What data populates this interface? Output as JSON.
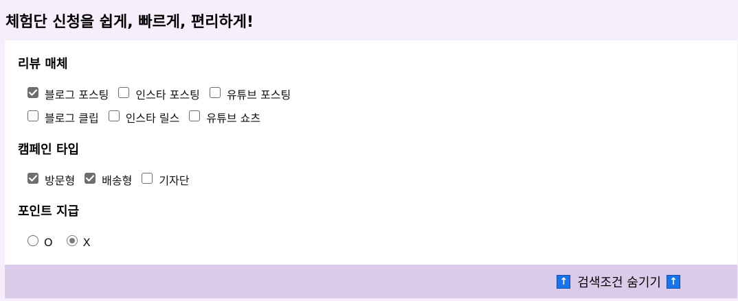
{
  "header": {
    "title": "체험단 신청을 쉽게, 빠르게, 편리하게!"
  },
  "filters": {
    "review_media": {
      "title": "리뷰 매체",
      "options_row1": [
        {
          "label": "블로그 포스팅",
          "checked": true
        },
        {
          "label": "인스타 포스팅",
          "checked": false
        },
        {
          "label": "유튜브 포스팅",
          "checked": false
        }
      ],
      "options_row2": [
        {
          "label": "블로그 클립",
          "checked": false
        },
        {
          "label": "인스타 릴스",
          "checked": false
        },
        {
          "label": "유튜브 쇼츠",
          "checked": false
        }
      ]
    },
    "campaign_type": {
      "title": "캠페인 타입",
      "options": [
        {
          "label": "방문형",
          "checked": true
        },
        {
          "label": "배송형",
          "checked": true
        },
        {
          "label": "기자단",
          "checked": false
        }
      ]
    },
    "point_payment": {
      "title": "포인트 지급",
      "options": [
        {
          "label": "O",
          "selected": false
        },
        {
          "label": "X",
          "selected": true
        }
      ]
    }
  },
  "footer": {
    "toggle_label": "검색조건 숨기기",
    "arrow_glyph": "↑",
    "arrow_icon": "up-arrow-icon"
  },
  "colors": {
    "page_background": "#f6eefb",
    "footer_background": "#dccaea",
    "checked_box": "#6e6e6e",
    "arrow_badge": "#1a73e8"
  }
}
